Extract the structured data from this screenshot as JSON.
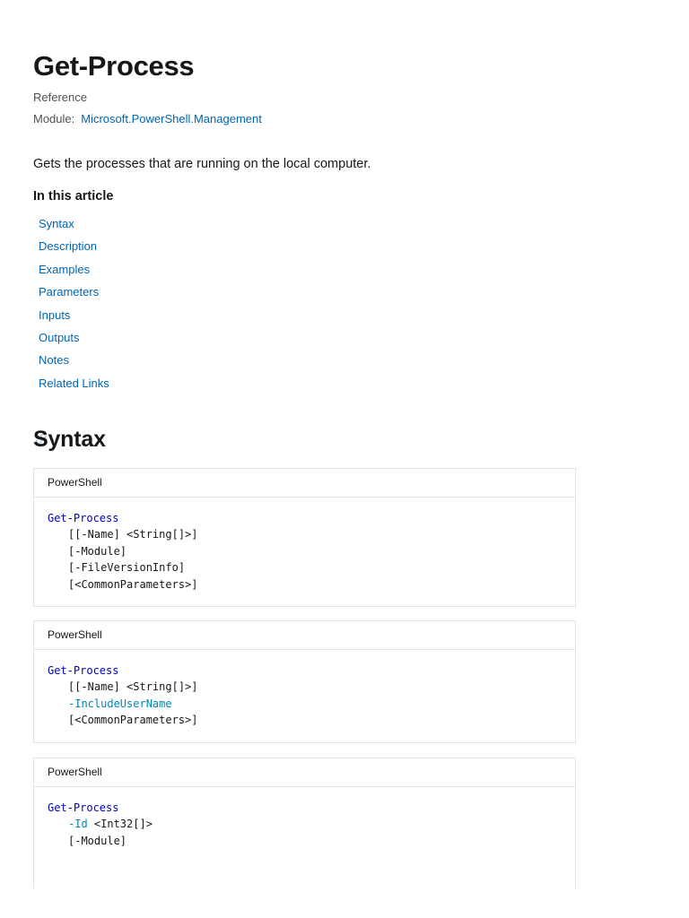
{
  "header": {
    "title": "Get-Process",
    "reference_label": "Reference",
    "module_label": "Module:",
    "module_link": "Microsoft.PowerShell.Management"
  },
  "summary": "Gets the processes that are running on the local computer.",
  "toc": {
    "heading": "In this article",
    "items": [
      {
        "label": "Syntax"
      },
      {
        "label": "Description"
      },
      {
        "label": "Examples"
      },
      {
        "label": "Parameters"
      },
      {
        "label": "Inputs"
      },
      {
        "label": "Outputs"
      },
      {
        "label": "Notes"
      },
      {
        "label": "Related Links"
      }
    ]
  },
  "syntax": {
    "heading": "Syntax",
    "blocks": [
      {
        "language": "PowerShell",
        "command": "Get-Process",
        "lines": [
          {
            "text": "[[-Name] <String[]>]",
            "kind": "plain"
          },
          {
            "text": "[-Module]",
            "kind": "plain"
          },
          {
            "text": "[-FileVersionInfo]",
            "kind": "plain"
          },
          {
            "text": "[<CommonParameters>]",
            "kind": "plain"
          }
        ]
      },
      {
        "language": "PowerShell",
        "command": "Get-Process",
        "lines": [
          {
            "text": "[[-Name] <String[]>]",
            "kind": "plain"
          },
          {
            "text": "-IncludeUserName",
            "kind": "param"
          },
          {
            "text": "[<CommonParameters>]",
            "kind": "plain"
          }
        ]
      },
      {
        "language": "PowerShell",
        "command": "Get-Process",
        "lines": [
          {
            "param": "-Id",
            "rest": " <Int32[]>",
            "kind": "mixed"
          },
          {
            "text": "[-Module]",
            "kind": "plain"
          }
        ]
      }
    ]
  }
}
